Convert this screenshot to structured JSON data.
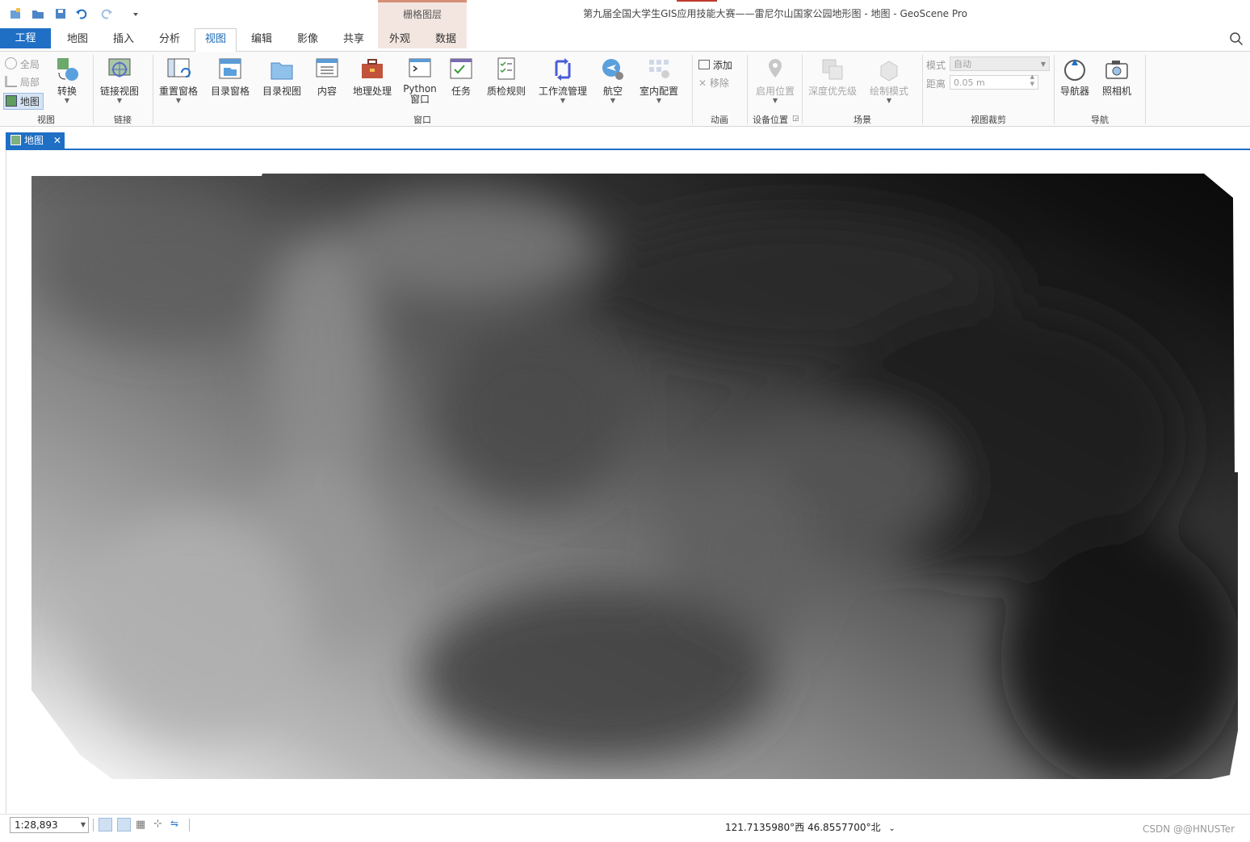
{
  "window": {
    "title": "第九届全国大学生GIS应用技能大赛——雷尼尔山国家公园地形图 - 地图 - GeoScene Pro",
    "context_tab_group": "栅格图层"
  },
  "tabs": [
    {
      "label": "工程"
    },
    {
      "label": "地图"
    },
    {
      "label": "插入"
    },
    {
      "label": "分析"
    },
    {
      "label": "视图"
    },
    {
      "label": "编辑"
    },
    {
      "label": "影像"
    },
    {
      "label": "共享"
    },
    {
      "label": "外观"
    },
    {
      "label": "数据"
    }
  ],
  "ribbon": {
    "view_group": {
      "label": "视图",
      "global": "全局",
      "local": "局部",
      "map": "地图",
      "convert": "转换"
    },
    "link_group": {
      "label": "链接",
      "link_views": "链接视图"
    },
    "window_group": {
      "label": "窗口",
      "reset_panes": "重置窗格",
      "catalog_pane": "目录窗格",
      "catalog_view": "目录视图",
      "contents": "内容",
      "geoprocessing": "地理处理",
      "python_line1": "Python",
      "python_line2": "窗口",
      "tasks": "任务",
      "qc_rules": "质检规则",
      "workflow": "工作流管理",
      "aviation": "航空",
      "indoor": "室内配置"
    },
    "animation_group": {
      "label": "动画",
      "add": "添加",
      "remove": "移除"
    },
    "device_group": {
      "label": "设备位置",
      "enable": "启用位置"
    },
    "scene_group": {
      "label": "场景",
      "depth_priority": "深度优先级",
      "draw_mode": "绘制模式"
    },
    "clip_group": {
      "label": "视图裁剪",
      "mode_label": "模式",
      "mode_value": "自动",
      "distance_label": "距离",
      "distance_value": "0.05 m"
    },
    "nav_group": {
      "label": "导航",
      "navigator": "导航器",
      "camera": "照相机"
    }
  },
  "doc_tab": {
    "label": "地图"
  },
  "status": {
    "scale": "1:28,893",
    "coordinates": "121.7135980°西 46.8557700°北",
    "watermark": "CSDN @@HNUSTer"
  },
  "colors": {
    "accent": "#1f6fc5",
    "context_tab": "#d68f78"
  }
}
